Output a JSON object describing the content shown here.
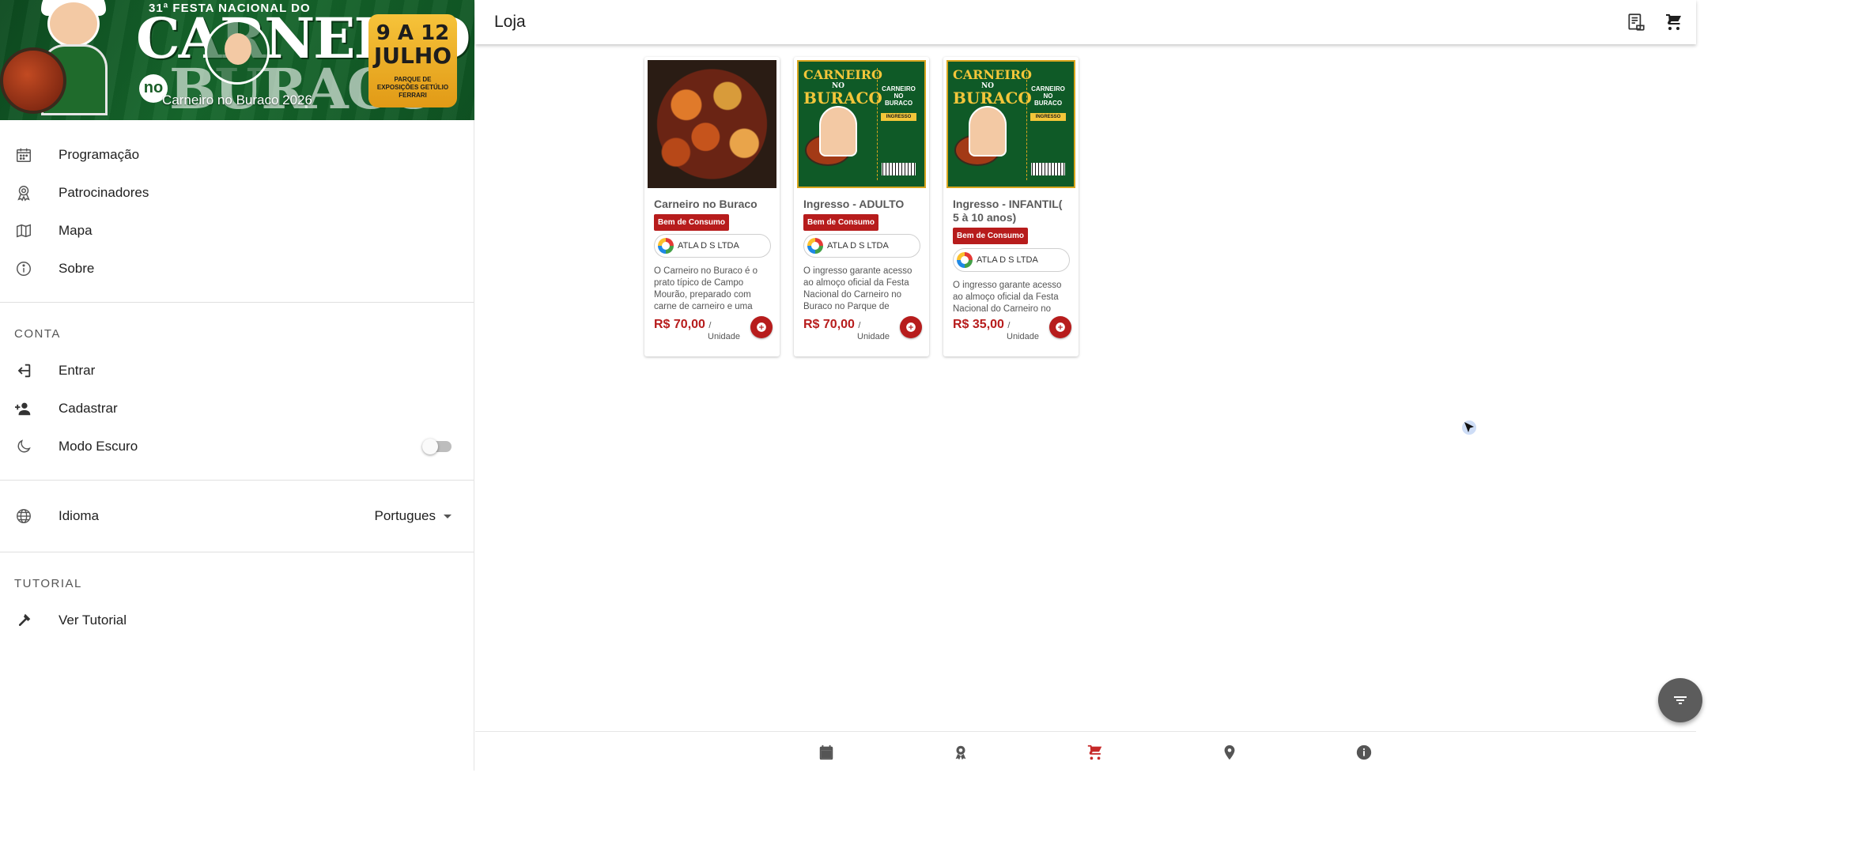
{
  "sidebar": {
    "banner": {
      "festa_line": "31ª FESTA NACIONAL DO",
      "title_line1": "CARNEIRO",
      "title_no": "no",
      "title_line2": "BURACO",
      "date_line1": "9 A 12",
      "date_line2": "JULHO",
      "date_line3": "PARQUE DE EXPOSIÇÕES GETÚLIO FERRARI",
      "caption": "Carneiro no Buraco 2026"
    },
    "nav": [
      {
        "label": "Programação",
        "icon": "calendar-icon"
      },
      {
        "label": "Patrocinadores",
        "icon": "award-ribbon-icon"
      },
      {
        "label": "Mapa",
        "icon": "map-icon"
      },
      {
        "label": "Sobre",
        "icon": "info-icon"
      }
    ],
    "conta_title": "CONTA",
    "conta": [
      {
        "label": "Entrar",
        "icon": "login-icon"
      },
      {
        "label": "Cadastrar",
        "icon": "person-add-icon"
      },
      {
        "label": "Modo Escuro",
        "icon": "moon-icon",
        "toggle_on": false
      }
    ],
    "idioma": {
      "label": "Idioma",
      "value": "Portugues",
      "icon": "globe-icon"
    },
    "tutorial_title": "TUTORIAL",
    "tutorial": {
      "label": "Ver Tutorial",
      "icon": "hammer-icon"
    }
  },
  "header": {
    "title": "Loja",
    "actions": [
      "receipt-icon",
      "cart-icon"
    ]
  },
  "products": [
    {
      "name": "Carneiro no Buraco",
      "badge": "Bem de Consumo",
      "vendor": "ATLA D S LTDA",
      "description": "O Carneiro no Buraco é o prato típico de Campo Mourão, preparado com carne de carneiro e uma",
      "price": "R$ 70,00",
      "slash": "/",
      "unit": "Unidade",
      "image": "food"
    },
    {
      "name": "Ingresso - ADULTO",
      "badge": "Bem de Consumo",
      "vendor": "ATLA D S LTDA",
      "description": "O ingresso garante acesso ao almoço oficial da Festa Nacional do Carneiro no Buraco no Parque de",
      "price": "R$ 70,00",
      "slash": "/",
      "unit": "Unidade",
      "image": "ticket"
    },
    {
      "name": "Ingresso - INFANTIL( 5 à 10 anos)",
      "badge": "Bem de Consumo",
      "vendor": "ATLA D S LTDA",
      "description": "O ingresso garante acesso ao almoço oficial da Festa Nacional do Carneiro no",
      "price": "R$ 35,00",
      "slash": "/",
      "unit": "Unidade",
      "image": "ticket"
    }
  ],
  "ticket_art": {
    "w1": "CARNEIRO",
    "w2": "NO",
    "w3": "BURACO",
    "stub": "CARNEIRO NO BURACO",
    "stub_tag": "INGRESSO"
  },
  "bottom_nav": [
    "calendar-icon",
    "award-icon",
    "cart-icon",
    "location-pin-icon",
    "info-icon"
  ],
  "colors": {
    "accent": "#b71c1c",
    "banner_green": "#16672c",
    "active_nav": "#c62828"
  }
}
